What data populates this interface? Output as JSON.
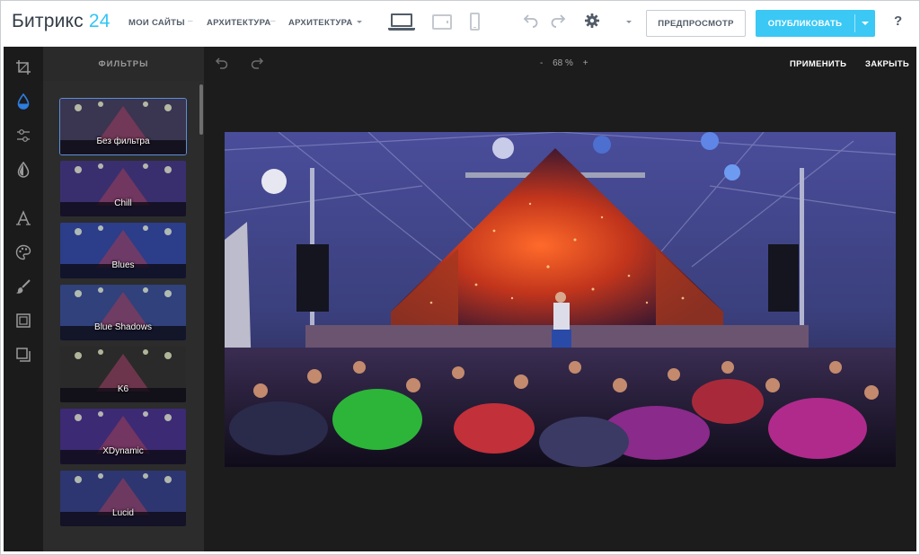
{
  "header": {
    "logo_text": "Битрикс",
    "logo_num": "24",
    "nav": [
      {
        "label": "МОИ САЙТЫ"
      },
      {
        "label": "АРХИТЕКТУРА"
      },
      {
        "label": "АРХИТЕКТУРА"
      }
    ],
    "preview_label": "ПРЕДПРОСМОТР",
    "publish_label": "ОПУБЛИКОВАТЬ",
    "help_label": "?",
    "accent": "#3bc8f5",
    "logo_accent": "#2fc6f6"
  },
  "editor": {
    "filters_title": "ФИЛЬТРЫ",
    "zoom_minus": "-",
    "zoom_value": "68 %",
    "zoom_plus": "+",
    "apply_label": "ПРИМЕНИТЬ",
    "close_label": "ЗАКРЫТЬ",
    "filters": [
      {
        "label": "Без фильтра",
        "tint": "#3a3550",
        "selected": true
      },
      {
        "label": "Chill",
        "tint": "#3a2f6e"
      },
      {
        "label": "Blues",
        "tint": "#2c3d8a"
      },
      {
        "label": "Blue Shadows",
        "tint": "#30417c"
      },
      {
        "label": "K6",
        "tint": "#2a2a2a"
      },
      {
        "label": "XDynamic",
        "tint": "#3c2a74"
      },
      {
        "label": "Lucid",
        "tint": "#2d3670"
      }
    ],
    "tools": [
      "crop-icon",
      "filter-drop-icon",
      "adjust-sliders-icon",
      "focus-drop-icon",
      "text-icon",
      "palette-icon",
      "brush-icon",
      "frame-icon",
      "overlay-icon"
    ]
  }
}
